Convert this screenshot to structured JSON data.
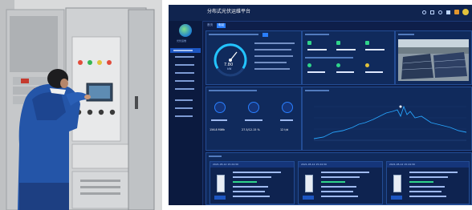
{
  "dashboard": {
    "app_title": "分布式光伏运维平台",
    "breadcrumb": [
      "首页",
      "电站"
    ],
    "logo_caption": "光伏运维",
    "gauge_value": "7.80",
    "gauge_label": "kW",
    "kpis": [
      {
        "value": "156.8 MWh"
      },
      {
        "value": "27.5/12.15 %"
      },
      {
        "value": "12 t/d"
      }
    ],
    "device_values": [
      "2021-05-12 15:24:30",
      "2021-05-12 15:24:30",
      "2021-05-12 15:24:30"
    ],
    "colors": {
      "background": "#0e1f4a",
      "panel": "#102a5c",
      "accent": "#2a7fff",
      "gauge": "#23c4ff",
      "line": "#27a6ff",
      "brand": "#1e88ff"
    }
  }
}
